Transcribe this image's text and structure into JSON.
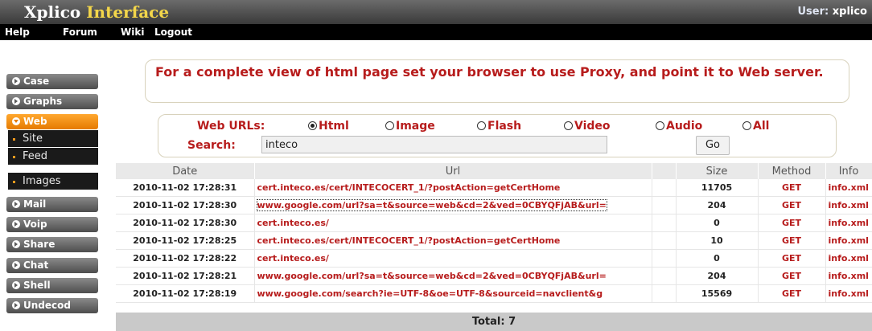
{
  "header": {
    "logo_word1": "Xplico",
    "logo_word2": "Interface",
    "user_label": "User:",
    "user_name": "xplico"
  },
  "menu": [
    "Help",
    "Forum",
    "Wiki",
    "Logout"
  ],
  "sidebar": {
    "items": [
      {
        "label": "Case"
      },
      {
        "label": "Graphs"
      },
      {
        "label": "Web",
        "active": true
      },
      {
        "label": "Mail"
      },
      {
        "label": "Voip"
      },
      {
        "label": "Share"
      },
      {
        "label": "Chat"
      },
      {
        "label": "Shell"
      },
      {
        "label": "Undecod"
      }
    ],
    "web_sub": [
      "Site",
      "Feed",
      "Images"
    ]
  },
  "notice": "For a complete view of html page set your browser to use Proxy, and point it to Web server.",
  "filter": {
    "web_urls_label": "Web URLs:",
    "search_label": "Search:",
    "options": [
      "Html",
      "Image",
      "Flash",
      "Video",
      "Audio",
      "All"
    ],
    "selected": "Html",
    "search_value": "inteco",
    "go_label": "Go"
  },
  "table": {
    "columns": [
      "Date",
      "Url",
      "",
      "Size",
      "Method",
      "Info"
    ],
    "rows": [
      {
        "date": "2010-11-02 17:28:31",
        "url": "cert.inteco.es/cert/INTECOCERT_1/?postAction=getCertHome",
        "size": "11705",
        "method": "GET",
        "info": "info.xml"
      },
      {
        "date": "2010-11-02 17:28:30",
        "url": "www.google.com/url?sa=t&source=web&cd=2&ved=0CBYQFjAB&url=",
        "size": "204",
        "method": "GET",
        "info": "info.xml"
      },
      {
        "date": "2010-11-02 17:28:30",
        "url": "cert.inteco.es/",
        "size": "0",
        "method": "GET",
        "info": "info.xml"
      },
      {
        "date": "2010-11-02 17:28:25",
        "url": "cert.inteco.es/cert/INTECOCERT_1/?postAction=getCertHome",
        "size": "10",
        "method": "GET",
        "info": "info.xml"
      },
      {
        "date": "2010-11-02 17:28:22",
        "url": "cert.inteco.es/",
        "size": "0",
        "method": "GET",
        "info": "info.xml"
      },
      {
        "date": "2010-11-02 17:28:21",
        "url": "www.google.com/url?sa=t&source=web&cd=2&ved=0CBYQFjAB&url=",
        "size": "204",
        "method": "GET",
        "info": "info.xml"
      },
      {
        "date": "2010-11-02 17:28:19",
        "url": "www.google.com/search?ie=UTF-8&oe=UTF-8&sourceid=navclient&g",
        "size": "15569",
        "method": "GET",
        "info": "info.xml"
      }
    ]
  },
  "total": "Total: 7",
  "colors": {
    "accent_red": "#b71c1c",
    "active_orange": "#f08a00",
    "logo_yellow": "#f3d64a"
  }
}
